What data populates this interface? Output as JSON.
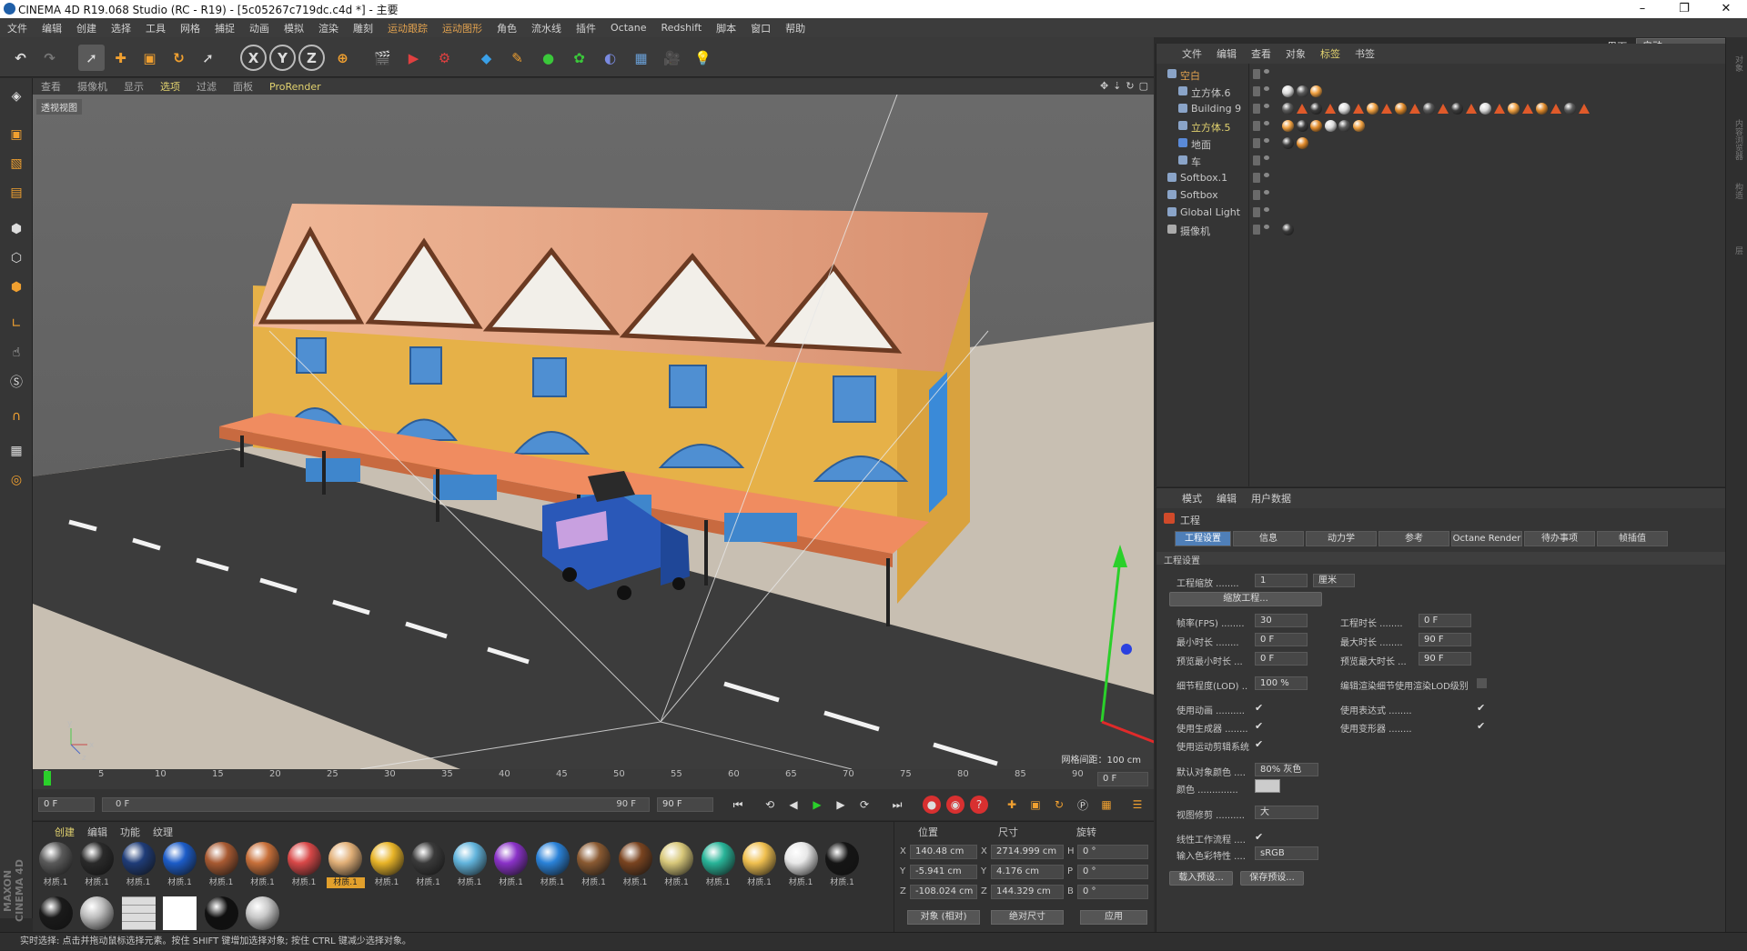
{
  "window": {
    "title": "CINEMA 4D R19.068 Studio (RC - R19) - [5c05267c719dc.c4d *] - 主要",
    "minimize": "–",
    "maximize": "❐",
    "close": "✕"
  },
  "menubar": {
    "items": [
      "文件",
      "编辑",
      "创建",
      "选择",
      "工具",
      "网格",
      "捕捉",
      "动画",
      "模拟",
      "渲染",
      "雕刻",
      "运动跟踪",
      "运动图形",
      "角色",
      "流水线",
      "插件",
      "Octane",
      "Redshift",
      "脚本",
      "窗口",
      "帮助"
    ],
    "layout_label": "界面:",
    "layout_value": "启动"
  },
  "viewport": {
    "menu": [
      "查看",
      "摄像机",
      "显示",
      "选项",
      "过滤",
      "面板",
      "ProRender"
    ],
    "name": "透视视图",
    "grid_info": "网格间距：100 cm"
  },
  "timeline": {
    "ticks": [
      "0",
      "5",
      "10",
      "15",
      "20",
      "25",
      "30",
      "35",
      "40",
      "45",
      "50",
      "55",
      "60",
      "65",
      "70",
      "75",
      "80",
      "85",
      "90"
    ],
    "current_frame": "0 F"
  },
  "transport": {
    "start_field": "0 F",
    "slider_start": "0 F",
    "slider_end": "90 F",
    "end_field": "90 F"
  },
  "material_manager": {
    "menu": [
      "创建",
      "编辑",
      "功能",
      "纹理"
    ],
    "materials": [
      {
        "label": "材质.1",
        "color": "#5a5a5a"
      },
      {
        "label": "材质.1",
        "color": "#2a2a2a"
      },
      {
        "label": "材质.1",
        "color": "#1f3c78"
      },
      {
        "label": "材质.1",
        "color": "#1c5cc8"
      },
      {
        "label": "材质.1",
        "color": "#a85a32"
      },
      {
        "label": "材质.1",
        "color": "#c8703a"
      },
      {
        "label": "材质.1",
        "color": "#d84848"
      },
      {
        "label": "材质.1",
        "color": "#e2b078",
        "selected": true
      },
      {
        "label": "材质.1",
        "color": "#e8b428"
      },
      {
        "label": "材质.1",
        "color": "#3a3a3a"
      },
      {
        "label": "材质.1",
        "color": "#62b4dc"
      },
      {
        "label": "材质.1",
        "color": "#8a32c8"
      },
      {
        "label": "材质.1",
        "color": "#2a82d8"
      },
      {
        "label": "材质.1",
        "color": "#8a5a32"
      },
      {
        "label": "材质.1",
        "color": "#7a4420"
      },
      {
        "label": "材质.1",
        "color": "#d8c87a"
      },
      {
        "label": "材质.1",
        "color": "#28b498"
      },
      {
        "label": "材质.1",
        "color": "#f0c050"
      },
      {
        "label": "材质.1",
        "color": "#e8e8e8"
      },
      {
        "label": "材质.1",
        "color": "#151515"
      }
    ],
    "materials_row2": [
      {
        "color": "#1a1a1a",
        "kind": "ball"
      },
      {
        "color": "#bdbdbd",
        "kind": "ball"
      },
      {
        "color": "#dcdcdc",
        "kind": "grid"
      },
      {
        "color": "#ffffff",
        "kind": "flat"
      },
      {
        "color": "#101010",
        "kind": "ball"
      },
      {
        "color": "#c8c8c8",
        "kind": "ball"
      }
    ]
  },
  "coordinates": {
    "headers": [
      "位置",
      "尺寸",
      "旋转"
    ],
    "rows": [
      {
        "axis": "X",
        "pos": "140.48 cm",
        "size_axis": "X",
        "size": "2714.999 cm",
        "rot_axis": "H",
        "rot": "0 °"
      },
      {
        "axis": "Y",
        "pos": "-5.941 cm",
        "size_axis": "Y",
        "size": "4.176 cm",
        "rot_axis": "P",
        "rot": "0 °"
      },
      {
        "axis": "Z",
        "pos": "-108.024 cm",
        "size_axis": "Z",
        "size": "144.329 cm",
        "rot_axis": "B",
        "rot": "0 °"
      }
    ],
    "mode_select": "对象 (相对)",
    "size_select": "绝对尺寸",
    "apply": "应用"
  },
  "object_manager": {
    "menu": [
      "文件",
      "编辑",
      "查看",
      "对象",
      "标签",
      "书签"
    ],
    "objects": [
      {
        "name": "空白",
        "indent": 0,
        "color": "#e2a24f",
        "icon": "null-icon"
      },
      {
        "name": "立方体.6",
        "indent": 1,
        "color": "#c8c8c8",
        "icon": "cube-icon"
      },
      {
        "name": "Building 9",
        "indent": 1,
        "color": "#c8c8c8",
        "icon": "cube-icon"
      },
      {
        "name": "立方体.5",
        "indent": 1,
        "color": "#e2d26f",
        "icon": "cube-icon"
      },
      {
        "name": "地面",
        "indent": 1,
        "color": "#c8c8c8",
        "icon": "floor-icon"
      },
      {
        "name": "车",
        "indent": 1,
        "color": "#c8c8c8",
        "icon": "null-icon"
      },
      {
        "name": "Softbox.1",
        "indent": 0,
        "color": "#c8c8c8",
        "icon": "null-icon"
      },
      {
        "name": "Softbox",
        "indent": 0,
        "color": "#c8c8c8",
        "icon": "null-icon"
      },
      {
        "name": "Global Light",
        "indent": 0,
        "color": "#c8c8c8",
        "icon": "null-icon"
      },
      {
        "name": "摄像机",
        "indent": 0,
        "color": "#c8c8c8",
        "icon": "camera-icon"
      }
    ]
  },
  "attribute_manager": {
    "menu": [
      "模式",
      "编辑",
      "用户数据"
    ],
    "object_title": "工程",
    "tabs": [
      "工程设置",
      "信息",
      "动力学",
      "参考",
      "Octane Render",
      "待办事项",
      "帧插值"
    ],
    "section": "工程设置",
    "fields": {
      "scale_label": "工程缩放 ........",
      "scale_value": "1",
      "scale_unit": "厘米",
      "scale_button": "缩放工程...",
      "fps_label": "帧率(FPS) ........",
      "fps_value": "30",
      "duration_label": "工程时长 ........",
      "duration_value": "0 F",
      "min_label": "最小时长 ........",
      "min_value": "0 F",
      "max_label": "最大时长 ........",
      "max_value": "90 F",
      "pmin_label": "预览最小时长 ...",
      "pmin_value": "0 F",
      "pmax_label": "预览最大时长 ...",
      "pmax_value": "90 F",
      "lod_label": "细节程度(LOD) ..",
      "lod_value": "100 %",
      "lod_check_label": "编辑渲染细节使用渲染LOD级别",
      "anim_label": "使用动画 ..........",
      "expr_label": "使用表达式 ........",
      "gen_label": "使用生成器 ........",
      "deform_label": "使用变形器 ........",
      "mograph_label": "使用运动剪辑系统",
      "default_color_label": "默认对象颜色 ....",
      "default_color_value": "80% 灰色",
      "color_label": "颜色 ..............",
      "view_clip_label": "视图修剪 ..........",
      "view_clip_value": "大",
      "linear_label": "线性工作流程 ....",
      "input_color_label": "输入色彩特性 ....",
      "input_color_value": "sRGB",
      "load_preset": "载入预设...",
      "save_preset": "保存预设..."
    }
  },
  "statusbar": {
    "text": "实时选择: 点击并拖动鼠标选择元素。按住 SHIFT 键增加选择对象; 按住 CTRL 键减少选择对象。"
  },
  "maxon_label": "MAXON CINEMA 4D",
  "right_strip": [
    "对象",
    "内容浏览器",
    "构造",
    "层"
  ],
  "colors": {
    "accent": "#e2a24f",
    "tab_active": "#4f7fb8",
    "highlight_yellow": "#e2d26f"
  }
}
